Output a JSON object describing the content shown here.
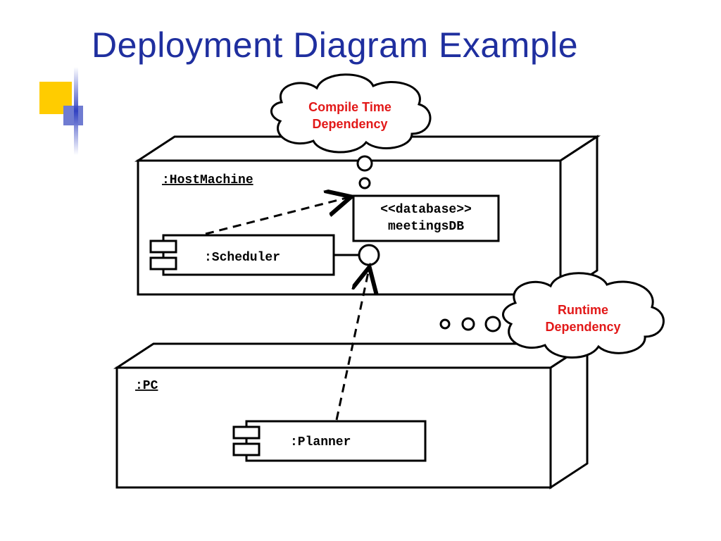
{
  "title": "Deployment Diagram Example",
  "callouts": {
    "compile_time": {
      "line1": "Compile Time",
      "line2": "Dependency"
    },
    "runtime": {
      "line1": "Runtime",
      "line2": "Dependency"
    }
  },
  "nodes": {
    "host": {
      "label": ":HostMachine"
    },
    "pc": {
      "label": ":PC"
    },
    "scheduler": {
      "label": ":Scheduler"
    },
    "planner": {
      "label": ":Planner"
    },
    "database": {
      "line1": "<<database>>",
      "line2": "meetingsDB"
    }
  },
  "colors": {
    "title": "#1f2f9f",
    "callout": "#e21818",
    "decor_yellow": "#ffcc00",
    "decor_blue": "#6f7bd1"
  }
}
